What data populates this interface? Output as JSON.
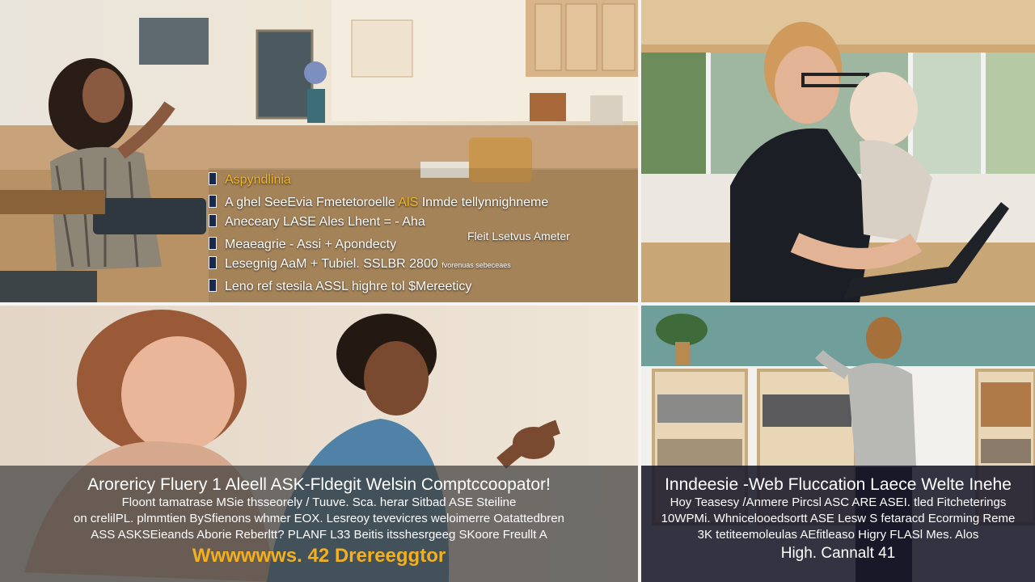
{
  "panels": {
    "top_left": {
      "list_items": [
        "Aspyndlinia",
        "A ghel SeeEvia Fmetetoroelle",
        "Aneceary LASE Ales Lhent = - Aha",
        "Meaeagrie - Assi + Apondecty",
        "Lesegnig AaM + Tubiel. SSLBR 2800",
        "Leno ref stesila ASSL highre tol $Mereeticy"
      ],
      "list_highlights": [
        "AlS",
        "Inmde tellynnighneme"
      ],
      "side_note": "Fleit Lsetvus Ameter",
      "small_note": "fvorenuas sebeceaes"
    },
    "bottom_left": {
      "caption_title": "Arorericy Fluery 1 Aleell ASK-Fldegit Welsin Comptccoopator!",
      "caption_lines": [
        "Floont tamatrase MSie thsseorely / Tuuve. Sca. herar Sitbad ASE Steiline",
        "on crelilPL. plmmtien BySfienons whmer EOX. Lesreoy tevevicres weloimerre Oatattedbren",
        "ASS ASKSEieands Aborie Reberltt? PLANF L33 Beitis itsshesrgeeg SKoore Freullt A"
      ],
      "caption_footer": "Wwwwwws. 42 Drereeggtor"
    },
    "bottom_right": {
      "caption_title": "Inndeesie -Web Fluccation Laece Welte Inehe",
      "caption_lines": [
        "Hoy Teasesy /Anmere Pircsl ASC ARE ASEI. tled Fitcheterings",
        "10WPMi. Whnicelooedsortt ASE Lesw S fetaracd Ecorming Reme",
        "3K tetiteemoleulas AEfitleaso Higry FLASl Mes. Alos"
      ],
      "caption_footer": "High. Cannalt 41"
    }
  },
  "colors": {
    "divider": "#f4f4f4",
    "highlight_gold": "#f0b62c",
    "caption_left_bg": "#3e3e3e",
    "caption_right_bg": "#18182a"
  }
}
